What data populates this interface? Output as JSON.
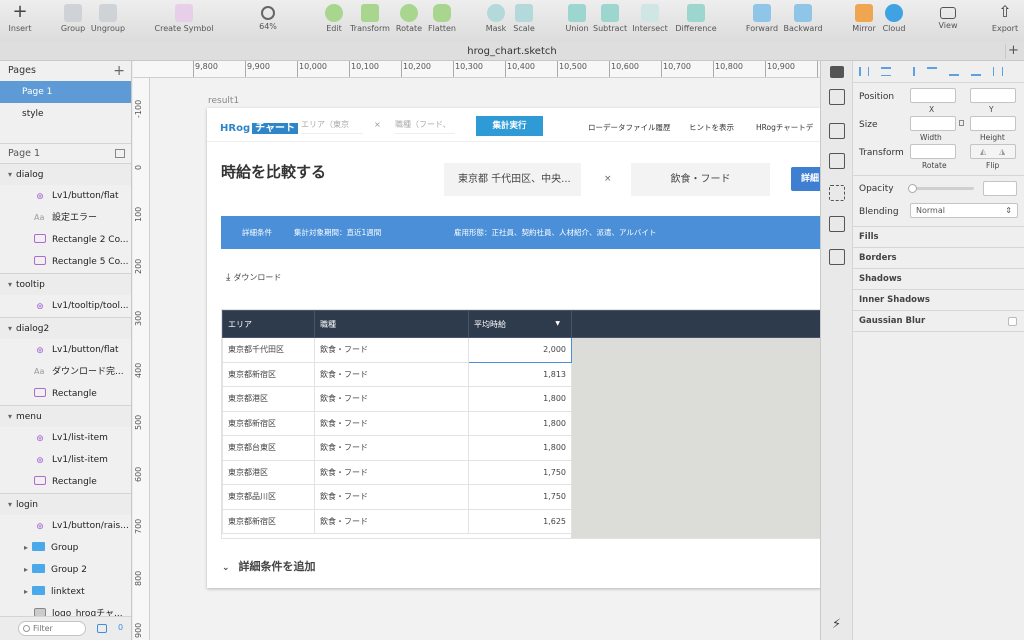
{
  "toolbar": {
    "items": [
      {
        "label": "Insert"
      },
      {
        "label": "Group"
      },
      {
        "label": "Ungroup"
      },
      {
        "label": "Create Symbol"
      },
      {
        "label": "64%"
      },
      {
        "label": "Edit"
      },
      {
        "label": "Transform"
      },
      {
        "label": "Rotate"
      },
      {
        "label": "Flatten"
      },
      {
        "label": "Mask"
      },
      {
        "label": "Scale"
      },
      {
        "label": "Union"
      },
      {
        "label": "Subtract"
      },
      {
        "label": "Intersect"
      },
      {
        "label": "Difference"
      },
      {
        "label": "Forward"
      },
      {
        "label": "Backward"
      },
      {
        "label": "Mirror"
      },
      {
        "label": "Cloud"
      },
      {
        "label": "View"
      },
      {
        "label": "Export"
      }
    ]
  },
  "document": {
    "title": "hrog_chart.sketch",
    "new_tab": "+"
  },
  "sidebar": {
    "pages_title": "Pages",
    "add_page": "+",
    "pages": [
      "Page 1",
      "style"
    ],
    "layers_title": "Page 1",
    "layers": [
      {
        "kind": "group",
        "label": "dialog"
      },
      {
        "kind": "symbol",
        "label": "Lv1/button/flat"
      },
      {
        "kind": "text",
        "label": "設定エラー"
      },
      {
        "kind": "rect",
        "label": "Rectangle 2 Co..."
      },
      {
        "kind": "rect",
        "label": "Rectangle 5 Co..."
      },
      {
        "kind": "group",
        "label": "tooltip"
      },
      {
        "kind": "symbol",
        "label": "Lv1/tooltip/tool..."
      },
      {
        "kind": "group",
        "label": "dialog2"
      },
      {
        "kind": "symbol",
        "label": "Lv1/button/flat"
      },
      {
        "kind": "text",
        "label": "ダウンロード完..."
      },
      {
        "kind": "rect",
        "label": "Rectangle"
      },
      {
        "kind": "group",
        "label": "menu"
      },
      {
        "kind": "symbol",
        "label": "Lv1/list-item"
      },
      {
        "kind": "symbol",
        "label": "Lv1/list-item"
      },
      {
        "kind": "rect",
        "label": "Rectangle"
      },
      {
        "kind": "group",
        "label": "login"
      },
      {
        "kind": "symbol",
        "label": "Lv1/button/rais..."
      },
      {
        "kind": "folder",
        "label": "Group"
      },
      {
        "kind": "folder",
        "label": "Group 2"
      },
      {
        "kind": "folder",
        "label": "linktext"
      },
      {
        "kind": "image",
        "label": "logo_hrogチャ..."
      }
    ],
    "filter_placeholder": "Filter",
    "filter_count": "0"
  },
  "ruler": {
    "top": [
      "9,800",
      "9,900",
      "10,000",
      "10,100",
      "10,200",
      "10,300",
      "10,400",
      "10,500",
      "10,600",
      "10,700",
      "10,800",
      "10,900",
      "11"
    ],
    "left": [
      "-100",
      "0",
      "100",
      "200",
      "300",
      "400",
      "500",
      "600",
      "700",
      "800",
      "900"
    ]
  },
  "artboard": {
    "name": "result1",
    "logo_a": "HRog",
    "logo_b": "チャート",
    "area_placeholder": "エリア（東京",
    "job_placeholder": "職種（フード、",
    "times": "×",
    "run_button": "集計実行",
    "nav": [
      "ローデータファイル履歴",
      "ヒントを表示",
      "HRogチャートデ"
    ],
    "heading": "時給を比較する",
    "area_value": "東京都 千代田区、中央...",
    "job_value": "飲食・フード",
    "detail_button": "詳細",
    "banner": {
      "label": "詳細条件",
      "period": "集計対象期間：直近1週間",
      "employment": "雇用形態：正社員、契約社員、人材紹介、派遣、アルバイト"
    },
    "download": "ダウンロード",
    "table": {
      "headers": [
        "エリア",
        "職種",
        "平均時給"
      ],
      "rows": [
        [
          "東京都千代田区",
          "飲食・フード",
          "2,000"
        ],
        [
          "東京都新宿区",
          "飲食・フード",
          "1,813"
        ],
        [
          "東京都港区",
          "飲食・フード",
          "1,800"
        ],
        [
          "東京都新宿区",
          "飲食・フード",
          "1,800"
        ],
        [
          "東京都台東区",
          "飲食・フード",
          "1,800"
        ],
        [
          "東京都港区",
          "飲食・フード",
          "1,750"
        ],
        [
          "東京都品川区",
          "飲食・フード",
          "1,750"
        ],
        [
          "東京都新宿区",
          "飲食・フード",
          "1,625"
        ]
      ]
    },
    "add_detail": "詳細条件を追加"
  },
  "inspector": {
    "position": "Position",
    "x": "X",
    "y": "Y",
    "size": "Size",
    "width": "Width",
    "height": "Height",
    "transform": "Transform",
    "rotate": "Rotate",
    "flip": "Flip",
    "opacity": "Opacity",
    "blending": "Blending",
    "blending_value": "Normal",
    "sections": [
      "Fills",
      "Borders",
      "Shadows",
      "Inner Shadows",
      "Gaussian Blur"
    ]
  },
  "colors": {
    "accent": "#4a90d9",
    "header_dark": "#2e3b4d",
    "selection": "#5e9bd6"
  }
}
